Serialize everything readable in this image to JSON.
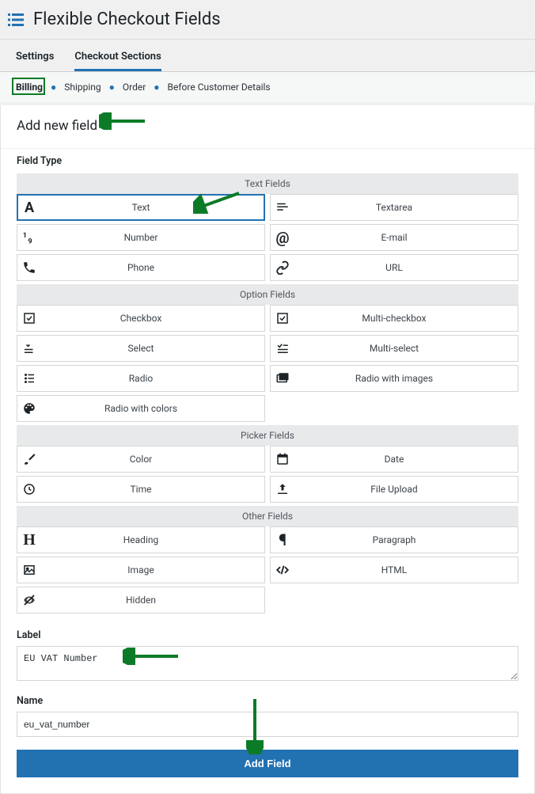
{
  "header": {
    "title": "Flexible Checkout Fields"
  },
  "tabs": {
    "settings": "Settings",
    "checkout_sections": "Checkout Sections"
  },
  "sections": {
    "billing": "Billing",
    "shipping": "Shipping",
    "order": "Order",
    "before": "Before Customer Details"
  },
  "panel_title": "Add new field",
  "field_type_label": "Field Type",
  "groups": {
    "text_fields": "Text Fields",
    "option_fields": "Option Fields",
    "picker_fields": "Picker Fields",
    "other_fields": "Other Fields"
  },
  "types": {
    "text": "Text",
    "textarea": "Textarea",
    "number": "Number",
    "email": "E-mail",
    "phone": "Phone",
    "url": "URL",
    "checkbox": "Checkbox",
    "multi_checkbox": "Multi-checkbox",
    "select": "Select",
    "multi_select": "Multi-select",
    "radio": "Radio",
    "radio_images": "Radio with images",
    "radio_colors": "Radio with colors",
    "color": "Color",
    "date": "Date",
    "time": "Time",
    "file": "File Upload",
    "heading": "Heading",
    "paragraph": "Paragraph",
    "image": "Image",
    "html": "HTML",
    "hidden": "Hidden"
  },
  "label_field": {
    "label": "Label",
    "value": "EU VAT Number"
  },
  "name_field": {
    "label": "Name",
    "value": "eu_vat_number"
  },
  "add_button": "Add Field"
}
